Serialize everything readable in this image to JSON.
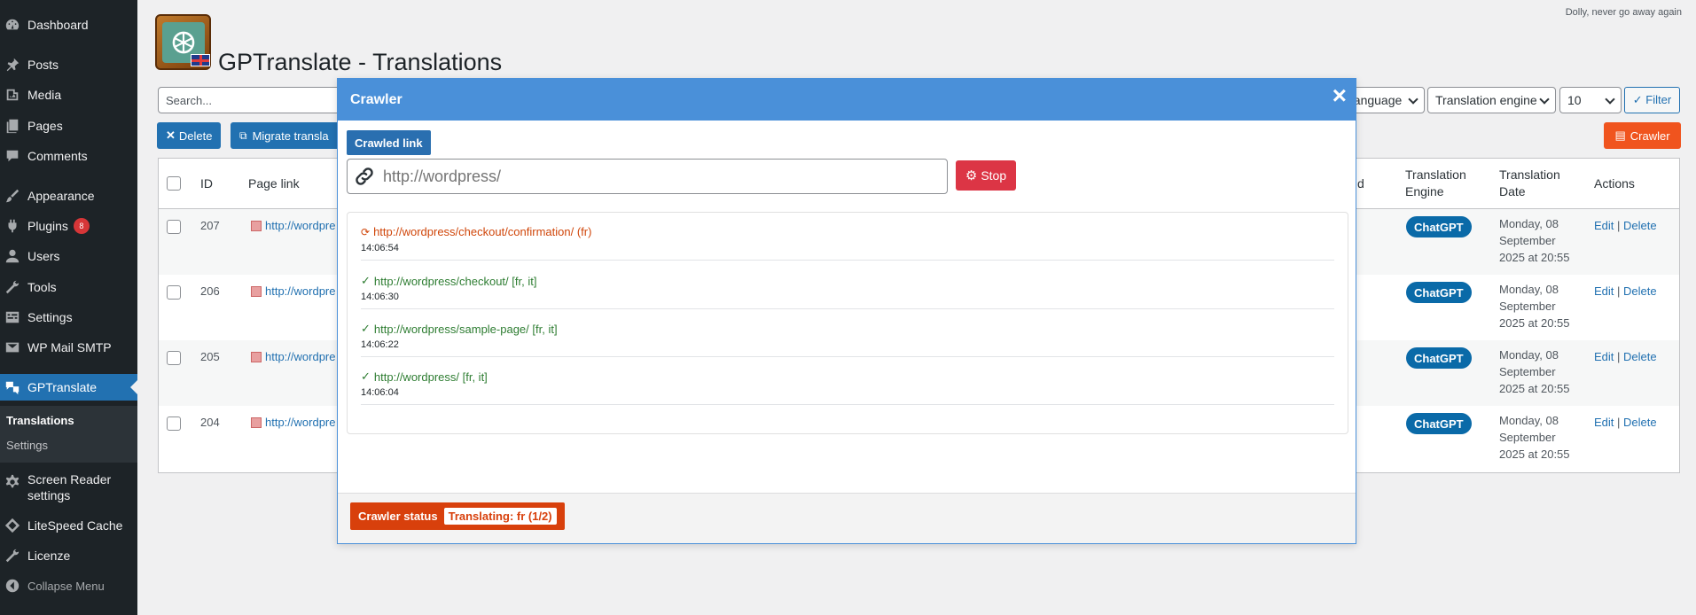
{
  "sidebar": {
    "items": [
      {
        "label": "Dashboard",
        "icon": "dashboard-icon"
      },
      {
        "label": "Posts",
        "icon": "pin-icon"
      },
      {
        "label": "Media",
        "icon": "media-icon"
      },
      {
        "label": "Pages",
        "icon": "pages-icon"
      },
      {
        "label": "Comments",
        "icon": "comments-icon"
      },
      {
        "label": "Appearance",
        "icon": "brush-icon"
      },
      {
        "label": "Plugins",
        "icon": "plugin-icon",
        "badge": "8"
      },
      {
        "label": "Users",
        "icon": "user-icon"
      },
      {
        "label": "Tools",
        "icon": "wrench-icon"
      },
      {
        "label": "Settings",
        "icon": "settings-icon"
      },
      {
        "label": "WP Mail SMTP",
        "icon": "mail-icon"
      },
      {
        "label": "GPTranslate",
        "icon": "translate-icon"
      },
      {
        "label": "Screen Reader settings",
        "icon": "gear-icon"
      },
      {
        "label": "LiteSpeed Cache",
        "icon": "diamond-icon"
      },
      {
        "label": "Licenze",
        "icon": "wrench-icon"
      },
      {
        "label": "Collapse Menu",
        "icon": "collapse-icon"
      }
    ],
    "submenu": [
      "Translations",
      "Settings"
    ]
  },
  "topbar": {
    "dolly": "Dolly, never go away again"
  },
  "page": {
    "title": "GPTranslate - Translations"
  },
  "filters": {
    "search_placeholder": "Search...",
    "language": "Language",
    "engine": "Translation engine",
    "per_page": "10",
    "filter_label": "✓ Filter"
  },
  "buttons": {
    "delete": "Delete",
    "migrate": "Migrate transla",
    "crawler": "Crawler"
  },
  "table": {
    "headers": {
      "id": "ID",
      "page_link": "Page link",
      "hidden_col": "d",
      "engine": "Translation Engine",
      "date": "Translation Date",
      "actions": "Actions"
    },
    "rows": [
      {
        "id": "207",
        "link": "http://wordpre",
        "engine": "ChatGPT",
        "date": "Monday, 08 September 2025 at 20:55"
      },
      {
        "id": "206",
        "link": "http://wordpre",
        "engine": "ChatGPT",
        "date": "Monday, 08 September 2025 at 20:55"
      },
      {
        "id": "205",
        "link": "http://wordpre",
        "engine": "ChatGPT",
        "date": "Monday, 08 September 2025 at 20:55"
      },
      {
        "id": "204",
        "link": "http://wordpre",
        "engine": "ChatGPT",
        "date": "Monday, 08 September 2025 at 20:55"
      }
    ],
    "action_edit": "Edit",
    "action_sep": "|",
    "action_delete": "Delete"
  },
  "modal": {
    "title": "Crawler",
    "close": "×",
    "crawled_label": "Crawled link",
    "url_placeholder": "http://wordpress/",
    "stop": "Stop",
    "log": [
      {
        "mark": "⟳",
        "text": "http://wordpress/checkout/confirmation/ (fr)",
        "time": "14:06:54",
        "state": "active"
      },
      {
        "mark": "✓",
        "text": "http://wordpress/checkout/ [fr, it]",
        "time": "14:06:30",
        "state": "done"
      },
      {
        "mark": "✓",
        "text": "http://wordpress/sample-page/ [fr, it]",
        "time": "14:06:22",
        "state": "done"
      },
      {
        "mark": "✓",
        "text": "http://wordpress/ [fr, it]",
        "time": "14:06:04",
        "state": "done"
      }
    ],
    "status_label": "Crawler status",
    "status_value": "Translating: fr (1/2)"
  },
  "colors": {
    "sidebar_bg": "#1d2327",
    "wp_blue": "#2271b1",
    "modal_header": "#4a90d9",
    "crawler_orange": "#f0541e",
    "stop_red": "#dc3545",
    "chatgpt_pill": "#0a6aa8"
  }
}
